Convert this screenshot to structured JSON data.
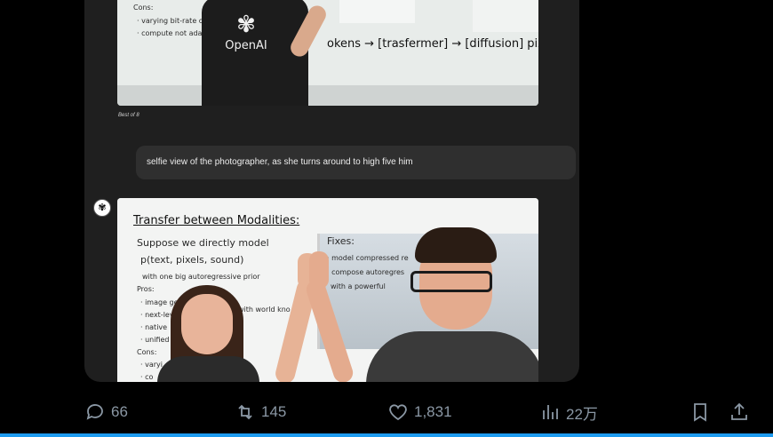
{
  "top_image": {
    "whiteboard_lines": [
      "Cons:",
      "· varying bit-rate c",
      "· compute not ada",
      "okens → [trasfermer] → [diffusion]  pixels"
    ],
    "shirt_text": "OpenAI",
    "caption": "Best of 8"
  },
  "prompt_bubble": {
    "text": "selfie view of the photographer, as she turns around to high five him"
  },
  "bottom_image": {
    "whiteboard_title": "Transfer between Modalities:",
    "whiteboard_lines": [
      "Suppose we directly model",
      "p(text, pixels, sound)",
      "with one big autoregressive prior",
      "Pros:",
      "· image ge",
      "· next-lev",
      "· native",
      "· unified",
      "Cons:",
      "· varyi",
      "· co"
    ],
    "whiteboard_mid": "with world kno",
    "fixes_title": "Fixes:",
    "fixes_lines": [
      "· model compressed re",
      "· compose autoregres",
      "with a powerful"
    ]
  },
  "actions": {
    "replies": "66",
    "reposts": "145",
    "likes": "1,831",
    "views": "22万"
  },
  "colors": {
    "accent": "#1d9bf0",
    "icon": "#8b98a5",
    "card": "#1f1f1f"
  }
}
